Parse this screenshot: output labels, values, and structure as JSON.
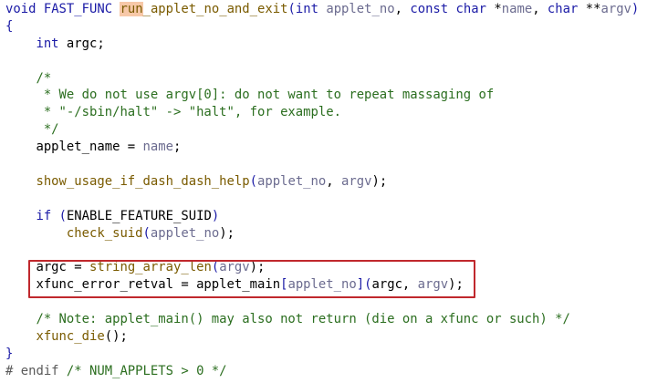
{
  "lines": [
    {
      "name": "line-signature",
      "tokens": [
        {
          "t": "void",
          "c": "ty"
        },
        {
          "t": " ",
          "c": ""
        },
        {
          "t": "FAST_FUNC",
          "c": "mc"
        },
        {
          "t": " ",
          "c": ""
        },
        {
          "t": "run",
          "c": "hl"
        },
        {
          "t": "_applet_no_and_exit",
          "c": "fn"
        },
        {
          "t": "(",
          "c": "br"
        },
        {
          "t": "int",
          "c": "ty"
        },
        {
          "t": " ",
          "c": ""
        },
        {
          "t": "applet_no",
          "c": "pa"
        },
        {
          "t": ", ",
          "c": ""
        },
        {
          "t": "const",
          "c": "kw"
        },
        {
          "t": " ",
          "c": ""
        },
        {
          "t": "char",
          "c": "ty"
        },
        {
          "t": " *",
          "c": ""
        },
        {
          "t": "name",
          "c": "pa"
        },
        {
          "t": ", ",
          "c": ""
        },
        {
          "t": "char",
          "c": "ty"
        },
        {
          "t": " **",
          "c": ""
        },
        {
          "t": "argv",
          "c": "pa"
        },
        {
          "t": ")",
          "c": "br"
        }
      ]
    },
    {
      "name": "line-open-brace",
      "tokens": [
        {
          "t": "{",
          "c": "br"
        }
      ]
    },
    {
      "name": "line-decl-argc",
      "tokens": [
        {
          "t": "    ",
          "c": ""
        },
        {
          "t": "int",
          "c": "ty"
        },
        {
          "t": " argc;",
          "c": ""
        }
      ]
    },
    {
      "name": "line-blank",
      "tokens": []
    },
    {
      "name": "line-comment-open",
      "tokens": [
        {
          "t": "    /*",
          "c": "co"
        }
      ]
    },
    {
      "name": "line-comment-1",
      "tokens": [
        {
          "t": "     * We do not use argv[0]: do not want to repeat massaging of",
          "c": "co"
        }
      ]
    },
    {
      "name": "line-comment-2",
      "tokens": [
        {
          "t": "     * \"-/sbin/halt\" -> \"halt\", for example.",
          "c": "co"
        }
      ]
    },
    {
      "name": "line-comment-close",
      "tokens": [
        {
          "t": "     */",
          "c": "co"
        }
      ]
    },
    {
      "name": "line-applet-name",
      "tokens": [
        {
          "t": "    applet_name = ",
          "c": ""
        },
        {
          "t": "name",
          "c": "pa"
        },
        {
          "t": ";",
          "c": ""
        }
      ]
    },
    {
      "name": "line-blank",
      "tokens": []
    },
    {
      "name": "line-show-usage",
      "tokens": [
        {
          "t": "    ",
          "c": ""
        },
        {
          "t": "show_usage_if_dash_dash_help",
          "c": "fn"
        },
        {
          "t": "(",
          "c": "br"
        },
        {
          "t": "applet_no",
          "c": "pa"
        },
        {
          "t": ", ",
          "c": ""
        },
        {
          "t": "argv",
          "c": "pa"
        },
        {
          "t": ");",
          "c": ""
        }
      ]
    },
    {
      "name": "line-blank",
      "tokens": []
    },
    {
      "name": "line-if-suid",
      "tokens": [
        {
          "t": "    ",
          "c": ""
        },
        {
          "t": "if",
          "c": "kw"
        },
        {
          "t": " ",
          "c": ""
        },
        {
          "t": "(",
          "c": "br"
        },
        {
          "t": "ENABLE_FEATURE_SUID",
          "c": ""
        },
        {
          "t": ")",
          "c": "br"
        }
      ]
    },
    {
      "name": "line-check-suid",
      "tokens": [
        {
          "t": "        ",
          "c": ""
        },
        {
          "t": "check_suid",
          "c": "pu"
        },
        {
          "t": "(",
          "c": "br"
        },
        {
          "t": "applet_no",
          "c": "pa"
        },
        {
          "t": ");",
          "c": ""
        }
      ]
    },
    {
      "name": "line-blank",
      "tokens": []
    },
    {
      "name": "line-argc-assign",
      "tokens": [
        {
          "t": "    argc = ",
          "c": ""
        },
        {
          "t": "string_array_len",
          "c": "fn"
        },
        {
          "t": "(",
          "c": "br"
        },
        {
          "t": "argv",
          "c": "pa"
        },
        {
          "t": ");",
          "c": ""
        }
      ]
    },
    {
      "name": "line-xfunc-retval",
      "tokens": [
        {
          "t": "    xfunc_error_retval = applet_main",
          "c": ""
        },
        {
          "t": "[",
          "c": "br"
        },
        {
          "t": "applet_no",
          "c": "idx"
        },
        {
          "t": "]",
          "c": "br"
        },
        {
          "t": "(",
          "c": "br"
        },
        {
          "t": "argc, ",
          "c": ""
        },
        {
          "t": "argv",
          "c": "pa"
        },
        {
          "t": ");",
          "c": ""
        }
      ]
    },
    {
      "name": "line-blank",
      "tokens": []
    },
    {
      "name": "line-note-comment",
      "tokens": [
        {
          "t": "    /* Note: applet_main() may also not return (die on a xfunc or such) */",
          "c": "co"
        }
      ]
    },
    {
      "name": "line-xfunc-die",
      "tokens": [
        {
          "t": "    ",
          "c": ""
        },
        {
          "t": "xfunc_die",
          "c": "fn"
        },
        {
          "t": "();",
          "c": ""
        }
      ]
    },
    {
      "name": "line-close-brace",
      "tokens": [
        {
          "t": "}",
          "c": "br"
        }
      ]
    },
    {
      "name": "line-endif",
      "tokens": [
        {
          "t": "# endif ",
          "c": "pp"
        },
        {
          "t": "/* NUM_APPLETS > 0 */",
          "c": "co"
        }
      ]
    }
  ],
  "colors": {
    "highlight_box_border": "#c0282d",
    "search_highlight_bg": "#f7c8a8"
  }
}
